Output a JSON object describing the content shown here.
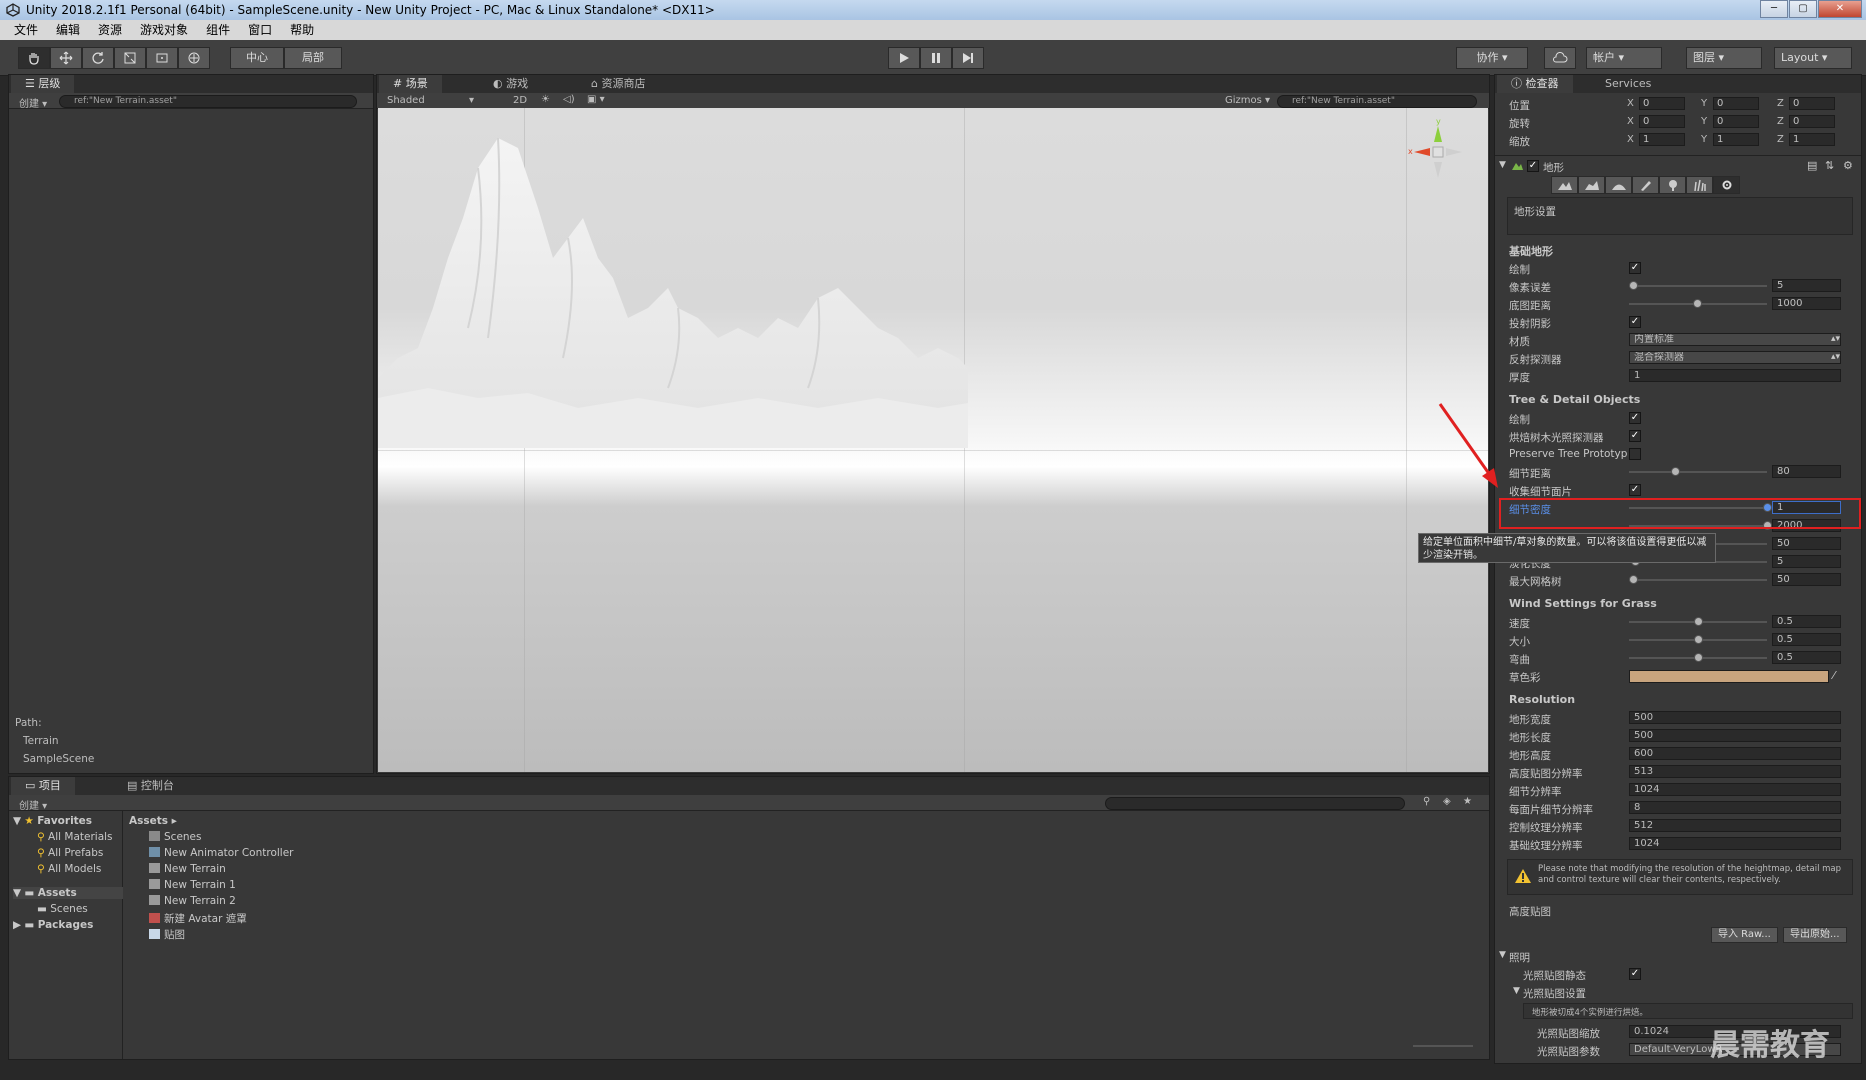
{
  "window": {
    "title": "Unity 2018.2.1f1 Personal (64bit) - SampleScene.unity - New Unity Project - PC, Mac & Linux Standalone* <DX11>",
    "controls": [
      "─",
      "▢",
      "✕"
    ]
  },
  "menu": [
    "文件",
    "编辑",
    "资源",
    "游戏对象",
    "组件",
    "窗口",
    "帮助"
  ],
  "toolbar": {
    "pivot": "中心",
    "space": "局部",
    "collab": "协作",
    "account": "帐户",
    "layers": "图层",
    "layout": "Layout"
  },
  "hierarchy": {
    "tab": "层级",
    "create": "创建",
    "search": "ref:\"New Terrain.asset\"",
    "path_label": "Path:",
    "path": [
      "Terrain",
      "SampleScene"
    ]
  },
  "scene": {
    "tabs": [
      "场景",
      "游戏",
      "资源商店"
    ],
    "shading": "Shaded",
    "mode_2d": "2D",
    "gizmos": "Gizmos",
    "search": "ref:\"New Terrain.asset\"",
    "axis_x": "x",
    "axis_y": "y"
  },
  "inspector": {
    "tabs": [
      "检查器",
      "Services"
    ],
    "transform": {
      "rows": [
        {
          "label": "位置",
          "x": "0",
          "y": "0",
          "z": "0"
        },
        {
          "label": "旋转",
          "x": "0",
          "y": "0",
          "z": "0"
        },
        {
          "label": "缩放",
          "x": "1",
          "y": "1",
          "z": "1"
        }
      ],
      "axis_labels": [
        "X",
        "Y",
        "Z"
      ]
    },
    "component_name": "地形",
    "settings_box": "地形设置",
    "basic_title": "基础地形",
    "basic": {
      "draw_label": "绘制",
      "pixel_error_label": "像素误差",
      "pixel_error": "5",
      "basemap_label": "底图距离",
      "basemap": "1000",
      "shadows_label": "投射阴影",
      "material_label": "材质",
      "material": "内置标准",
      "reflection_label": "反射探测器",
      "reflection": "混合探测器",
      "thickness_label": "厚度",
      "thickness": "1"
    },
    "tree_title": "Tree & Detail Objects",
    "tree": {
      "draw_label": "绘制",
      "bake_label": "烘焙树木光照探测器",
      "preserve_label": "Preserve Tree Prototyp",
      "detail_dist_label": "细节距离",
      "detail_dist": "80",
      "collect_label": "收集细节面片",
      "density_label": "细节密度",
      "density": "1",
      "tree_dist": "2000",
      "billboard": "50",
      "fade_label": "淡化长度",
      "fade": "5",
      "max_mesh_label": "最大网格树",
      "max_mesh": "50"
    },
    "tooltip": "给定单位面积中细节/草对象的数量。可以将该值设置得更低以减少渲染开销。",
    "wind_title": "Wind Settings for Grass",
    "wind": [
      {
        "label": "速度",
        "value": "0.5"
      },
      {
        "label": "大小",
        "value": "0.5"
      },
      {
        "label": "弯曲",
        "value": "0.5"
      }
    ],
    "grass_tint_label": "草色彩",
    "resolution_title": "Resolution",
    "resolution": [
      {
        "label": "地形宽度",
        "value": "500"
      },
      {
        "label": "地形长度",
        "value": "500"
      },
      {
        "label": "地形高度",
        "value": "600"
      },
      {
        "label": "高度贴图分辨率",
        "value": "513"
      },
      {
        "label": "细节分辨率",
        "value": "1024"
      },
      {
        "label": "每面片细节分辨率",
        "value": "8"
      },
      {
        "label": "控制纹理分辨率",
        "value": "512"
      },
      {
        "label": "基础纹理分辨率",
        "value": "1024"
      }
    ],
    "warning": "Please note that modifying the resolution of the heightmap, detail map and control texture will clear their contents, respectively.",
    "heightmap_label": "高度贴图",
    "import_raw": "导入 Raw...",
    "export_raw": "导出原始...",
    "lighting_title": "照明",
    "lightmap_static_label": "光照贴图静态",
    "lightmap_settings_label": "光照贴图设置",
    "lightmap_info": "地形被切成4个实例进行烘焙。",
    "lightmap_scale_label": "光照贴图缩放",
    "lightmap_scale": "0.1024",
    "lightmap_params_label": "光照贴图参数",
    "lightmap_params": "Default-VeryLowR"
  },
  "project": {
    "tabs": [
      "项目",
      "控制台"
    ],
    "create": "创建",
    "favorites_label": "Favorites",
    "favorites": [
      "All Materials",
      "All Prefabs",
      "All Models"
    ],
    "assets_label": "Assets",
    "assets_sub": [
      "Scenes"
    ],
    "packages_label": "Packages",
    "breadcrumb": "Assets",
    "items": [
      "Scenes",
      "New Animator Controller",
      "New Terrain",
      "New Terrain 1",
      "New Terrain 2",
      "新建 Avatar 遮罩",
      "贴图"
    ]
  },
  "watermark": "晨需教育",
  "colors": {
    "accent_red": "#e02020",
    "grass_tint": "#c8a47e",
    "selection": "#3d6ec9"
  }
}
